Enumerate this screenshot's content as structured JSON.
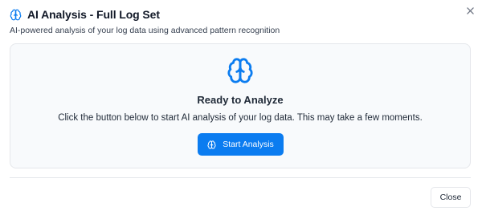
{
  "header": {
    "title": "AI Analysis - Full Log Set",
    "subtitle": "AI-powered analysis of your log data using advanced pattern recognition",
    "title_icon": "brain-icon",
    "close_icon": "close-icon"
  },
  "panel": {
    "icon": "brain-icon",
    "heading": "Ready to Analyze",
    "description": "Click the button below to start AI analysis of your log data. This may take a few moments.",
    "start_button": {
      "label": "Start Analysis",
      "icon": "brain-icon"
    }
  },
  "footer": {
    "close_label": "Close"
  },
  "colors": {
    "accent": "#0b7cf0",
    "panel_background": "#f8fafc",
    "border": "#e5e7eb",
    "text": "#1f2937"
  }
}
